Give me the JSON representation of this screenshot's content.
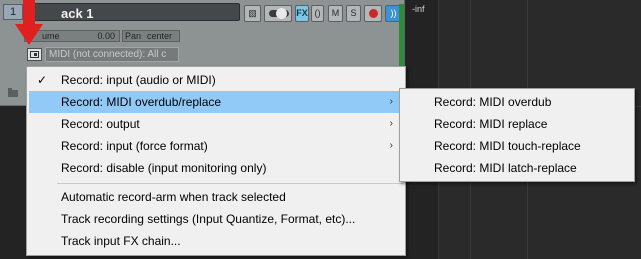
{
  "track": {
    "number": "1",
    "name": "ack 1",
    "buttons": {
      "envelope": "▧",
      "fx": "FX",
      "phase": "()",
      "mute": "M",
      "solo": "S",
      "record_arm": "",
      "io": "))"
    },
    "volume_label": "ume",
    "volume_value": "0.00",
    "pan_label": "Pan",
    "pan_value": "center",
    "input_selector": "MIDI (not connected): All c",
    "meter_readout": "-inf"
  },
  "menu": {
    "items": [
      {
        "label": "Record: input (audio or MIDI)",
        "checked": true,
        "submenu": false
      },
      {
        "label": "Record: MIDI overdub/replace",
        "checked": false,
        "submenu": true,
        "highlighted": true
      },
      {
        "label": "Record: output",
        "checked": false,
        "submenu": true
      },
      {
        "label": "Record: input (force format)",
        "checked": false,
        "submenu": true
      },
      {
        "label": "Record: disable (input monitoring only)",
        "checked": false,
        "submenu": false
      },
      {
        "label": "Automatic record-arm when track selected",
        "checked": false,
        "submenu": false
      },
      {
        "label": "Track recording settings (Input Quantize, Format, etc)...",
        "checked": false,
        "submenu": false
      },
      {
        "label": "Track input FX chain...",
        "checked": false,
        "submenu": false
      }
    ],
    "check_glyph": "✓",
    "submenu_glyph": "›"
  },
  "submenu": {
    "items": [
      {
        "label": "Record: MIDI overdub"
      },
      {
        "label": "Record: MIDI replace"
      },
      {
        "label": "Record: MIDI touch-replace"
      },
      {
        "label": "Record: MIDI latch-replace"
      }
    ]
  },
  "colors": {
    "highlight": "#91c9f7",
    "annotation_arrow": "#e0201f",
    "track_bg": "#8d9293",
    "record_dot": "#c92828",
    "fx_active": "#7ec6e6",
    "io_button": "#3d92d4"
  }
}
